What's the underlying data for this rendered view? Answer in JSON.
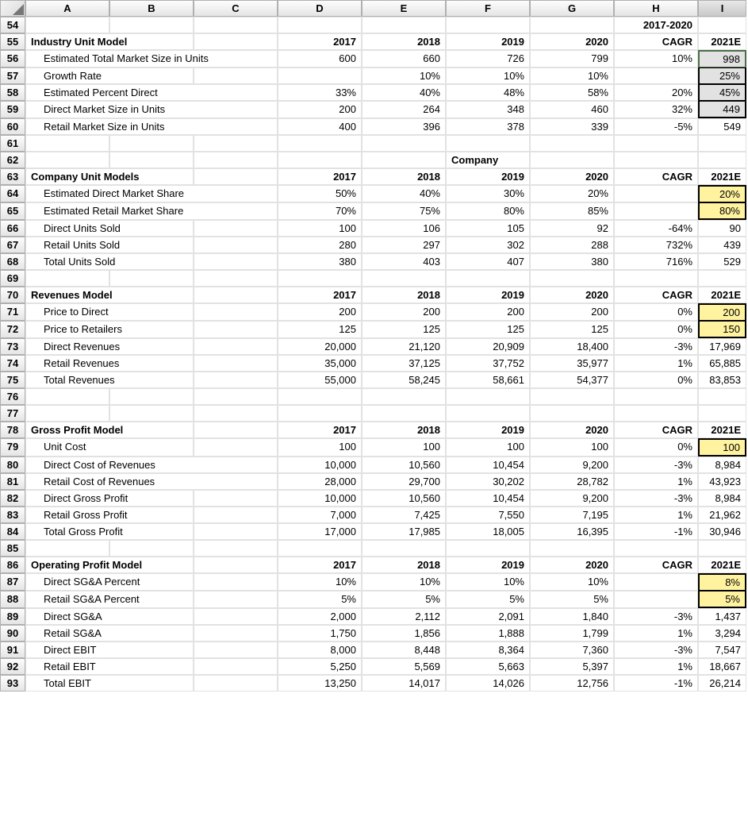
{
  "cols": [
    "A",
    "B",
    "C",
    "D",
    "E",
    "F",
    "G",
    "H",
    "I"
  ],
  "topright": "2017-2020",
  "sections": {
    "industry": {
      "title": "Industry Unit Model",
      "head": {
        "d": "2017",
        "e": "2018",
        "f": "2019",
        "g": "2020",
        "h": "CAGR",
        "i": "2021E"
      },
      "r56": {
        "label": "Estimated Total Market Size in Units",
        "d": "600",
        "e": "660",
        "f": "726",
        "g": "799",
        "h": "10%",
        "i": "998"
      },
      "r57": {
        "label": "Growth Rate",
        "e": "10%",
        "f": "10%",
        "g": "10%",
        "i": "25%"
      },
      "r58": {
        "label": "Estimated Percent Direct",
        "d": "33%",
        "e": "40%",
        "f": "48%",
        "g": "58%",
        "h": "20%",
        "i": "45%"
      },
      "r59": {
        "label": "Direct Market Size in Units",
        "d": "200",
        "e": "264",
        "f": "348",
        "g": "460",
        "h": "32%",
        "i": "449"
      },
      "r60": {
        "label": "Retail Market Size in Units",
        "d": "400",
        "e": "396",
        "f": "378",
        "g": "339",
        "h": "-5%",
        "i": "549"
      }
    },
    "companyHeader": "Company",
    "company": {
      "title": "Company Unit Models",
      "head": {
        "d": "2017",
        "e": "2018",
        "f": "2019",
        "g": "2020",
        "h": "CAGR",
        "i": "2021E"
      },
      "r64": {
        "label": "Estimated Direct Market Share",
        "d": "50%",
        "e": "40%",
        "f": "30%",
        "g": "20%",
        "i": "20%"
      },
      "r65": {
        "label": "Estimated Retail Market Share",
        "d": "70%",
        "e": "75%",
        "f": "80%",
        "g": "85%",
        "i": "80%"
      },
      "r66": {
        "label": "Direct Units Sold",
        "d": "100",
        "e": "106",
        "f": "105",
        "g": "92",
        "h": "-64%",
        "i": "90"
      },
      "r67": {
        "label": "Retail Units Sold",
        "d": "280",
        "e": "297",
        "f": "302",
        "g": "288",
        "h": "732%",
        "i": "439"
      },
      "r68": {
        "label": "Total Units Sold",
        "d": "380",
        "e": "403",
        "f": "407",
        "g": "380",
        "h": "716%",
        "i": "529"
      }
    },
    "rev": {
      "title": "Revenues Model",
      "head": {
        "d": "2017",
        "e": "2018",
        "f": "2019",
        "g": "2020",
        "h": "CAGR",
        "i": "2021E"
      },
      "r71": {
        "label": "Price to Direct",
        "d": "200",
        "e": "200",
        "f": "200",
        "g": "200",
        "h": "0%",
        "i": "200"
      },
      "r72": {
        "label": "Price to Retailers",
        "d": "125",
        "e": "125",
        "f": "125",
        "g": "125",
        "h": "0%",
        "i": "150"
      },
      "r73": {
        "label": "Direct Revenues",
        "d": "20,000",
        "e": "21,120",
        "f": "20,909",
        "g": "18,400",
        "h": "-3%",
        "i": "17,969"
      },
      "r74": {
        "label": "Retail Revenues",
        "d": "35,000",
        "e": "37,125",
        "f": "37,752",
        "g": "35,977",
        "h": "1%",
        "i": "65,885"
      },
      "r75": {
        "label": "Total Revenues",
        "d": "55,000",
        "e": "58,245",
        "f": "58,661",
        "g": "54,377",
        "h": "0%",
        "i": "83,853"
      }
    },
    "gp": {
      "title": "Gross Profit Model",
      "head": {
        "d": "2017",
        "e": "2018",
        "f": "2019",
        "g": "2020",
        "h": "CAGR",
        "i": "2021E"
      },
      "r79": {
        "label": "Unit Cost",
        "d": "100",
        "e": "100",
        "f": "100",
        "g": "100",
        "h": "0%",
        "i": "100"
      },
      "r80": {
        "label": "Direct Cost of Revenues",
        "d": "10,000",
        "e": "10,560",
        "f": "10,454",
        "g": "9,200",
        "h": "-3%",
        "i": "8,984"
      },
      "r81": {
        "label": "Retail Cost of Revenues",
        "d": "28,000",
        "e": "29,700",
        "f": "30,202",
        "g": "28,782",
        "h": "1%",
        "i": "43,923"
      },
      "r82": {
        "label": "Direct Gross Profit",
        "d": "10,000",
        "e": "10,560",
        "f": "10,454",
        "g": "9,200",
        "h": "-3%",
        "i": "8,984"
      },
      "r83": {
        "label": "Retail Gross Profit",
        "d": "7,000",
        "e": "7,425",
        "f": "7,550",
        "g": "7,195",
        "h": "1%",
        "i": "21,962"
      },
      "r84": {
        "label": "Total Gross Profit",
        "d": "17,000",
        "e": "17,985",
        "f": "18,005",
        "g": "16,395",
        "h": "-1%",
        "i": "30,946"
      }
    },
    "op": {
      "title": "Operating Profit Model",
      "head": {
        "d": "2017",
        "e": "2018",
        "f": "2019",
        "g": "2020",
        "h": "CAGR",
        "i": "2021E"
      },
      "r87": {
        "label": "Direct SG&A Percent",
        "d": "10%",
        "e": "10%",
        "f": "10%",
        "g": "10%",
        "i": "8%"
      },
      "r88": {
        "label": "Retail SG&A Percent",
        "d": "5%",
        "e": "5%",
        "f": "5%",
        "g": "5%",
        "i": "5%"
      },
      "r89": {
        "label": "Direct SG&A",
        "d": "2,000",
        "e": "2,112",
        "f": "2,091",
        "g": "1,840",
        "h": "-3%",
        "i": "1,437"
      },
      "r90": {
        "label": "Retail SG&A",
        "d": "1,750",
        "e": "1,856",
        "f": "1,888",
        "g": "1,799",
        "h": "1%",
        "i": "3,294"
      },
      "r91": {
        "label": "Direct EBIT",
        "d": "8,000",
        "e": "8,448",
        "f": "8,364",
        "g": "7,360",
        "h": "-3%",
        "i": "7,547"
      },
      "r92": {
        "label": "Retail EBIT",
        "d": "5,250",
        "e": "5,569",
        "f": "5,663",
        "g": "5,397",
        "h": "1%",
        "i": "18,667"
      },
      "r93": {
        "label": "Total EBIT",
        "d": "13,250",
        "e": "14,017",
        "f": "14,026",
        "g": "12,756",
        "h": "-1%",
        "i": "26,214"
      }
    }
  },
  "rows": [
    "54",
    "55",
    "56",
    "57",
    "58",
    "59",
    "60",
    "61",
    "62",
    "63",
    "64",
    "65",
    "66",
    "67",
    "68",
    "69",
    "70",
    "71",
    "72",
    "73",
    "74",
    "75",
    "76",
    "77",
    "78",
    "79",
    "80",
    "81",
    "82",
    "83",
    "84",
    "85",
    "86",
    "87",
    "88",
    "89",
    "90",
    "91",
    "92",
    "93"
  ]
}
